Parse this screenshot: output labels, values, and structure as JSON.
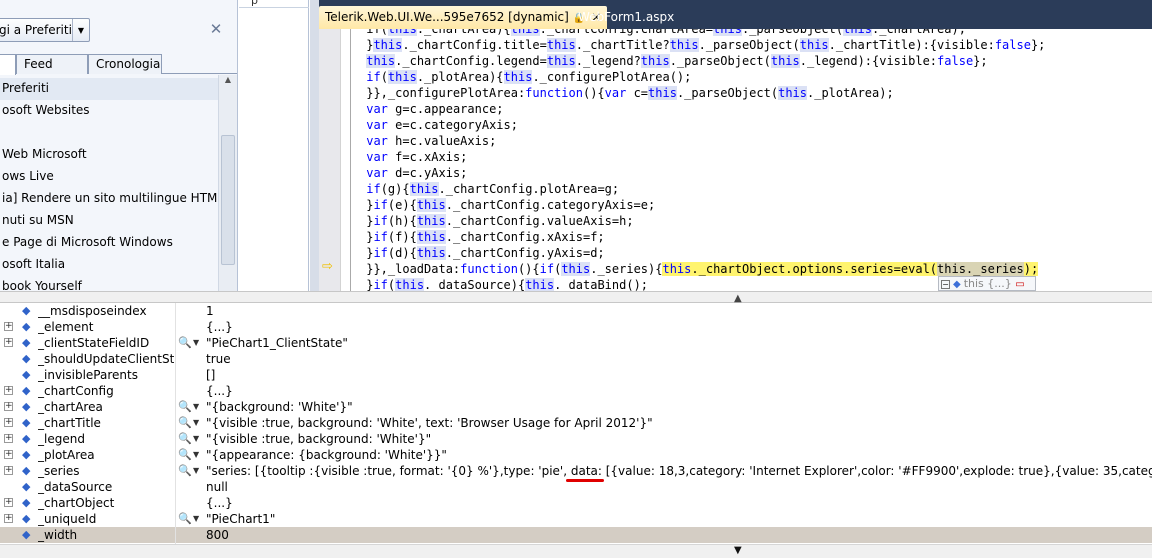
{
  "favorites": {
    "add_button_label": "gi a Preferiti",
    "tabs": [
      "",
      "Feed",
      "Cronologia"
    ],
    "items": [
      "Preferiti",
      "osoft Websites",
      "",
      "Web Microsoft",
      "ows Live",
      "ia] Rendere un sito multilingue HTML....",
      "nuti su MSN",
      "e Page di Microsoft Windows",
      "osoft Italia",
      "book Yourself"
    ]
  },
  "middle_pane": {
    "text": "p"
  },
  "editor": {
    "tabs": [
      {
        "label": "Telerik.Web.UI.We...595e7652 [dynamic]",
        "lock": "🔒",
        "close": "×"
      },
      {
        "label": "WebForm1.aspx"
      }
    ],
    "tooltip": {
      "expand": "−",
      "text": "this",
      "value": "{...}"
    }
  },
  "watch": {
    "rows": [
      {
        "expand": false,
        "name": "__msdisposeindex",
        "inspect": false,
        "value": "1"
      },
      {
        "expand": true,
        "name": "_element",
        "inspect": false,
        "value": "{...}"
      },
      {
        "expand": true,
        "name": "_clientStateFieldID",
        "inspect": true,
        "value": "\"PieChart1_ClientState\""
      },
      {
        "expand": false,
        "name": "_shouldUpdateClientState",
        "inspect": false,
        "value": "true"
      },
      {
        "expand": false,
        "name": "_invisibleParents",
        "inspect": false,
        "value": "[]"
      },
      {
        "expand": true,
        "name": "_chartConfig",
        "inspect": false,
        "value": "{...}"
      },
      {
        "expand": true,
        "name": "_chartArea",
        "inspect": true,
        "value": "\"{background: 'White'}\""
      },
      {
        "expand": true,
        "name": "_chartTitle",
        "inspect": true,
        "value": "\"{visible :true, background: 'White', text: 'Browser Usage for April 2012'}\""
      },
      {
        "expand": true,
        "name": "_legend",
        "inspect": true,
        "value": "\"{visible :true, background: 'White'}\""
      },
      {
        "expand": true,
        "name": "_plotArea",
        "inspect": true,
        "value": "\"{appearance: {background: 'White'}}\""
      },
      {
        "expand": true,
        "name": "_series",
        "inspect": true,
        "value": "\"series: [{tooltip :{visible :true, format: '{0} %'},type: 'pie', data: [{value: 18,3,category: 'Internet Explorer',color: '#FF9900',explode: true},{value: 35,category: 'Firefox',color: '#CCCCCC',"
      },
      {
        "expand": false,
        "name": "_dataSource",
        "inspect": false,
        "value": "null"
      },
      {
        "expand": true,
        "name": "_chartObject",
        "inspect": false,
        "value": "{...}"
      },
      {
        "expand": true,
        "name": "_uniqueId",
        "inspect": true,
        "value": "\"PieChart1\""
      },
      {
        "expand": false,
        "name": "_width",
        "inspect": false,
        "value": "800",
        "selected": true
      }
    ]
  }
}
